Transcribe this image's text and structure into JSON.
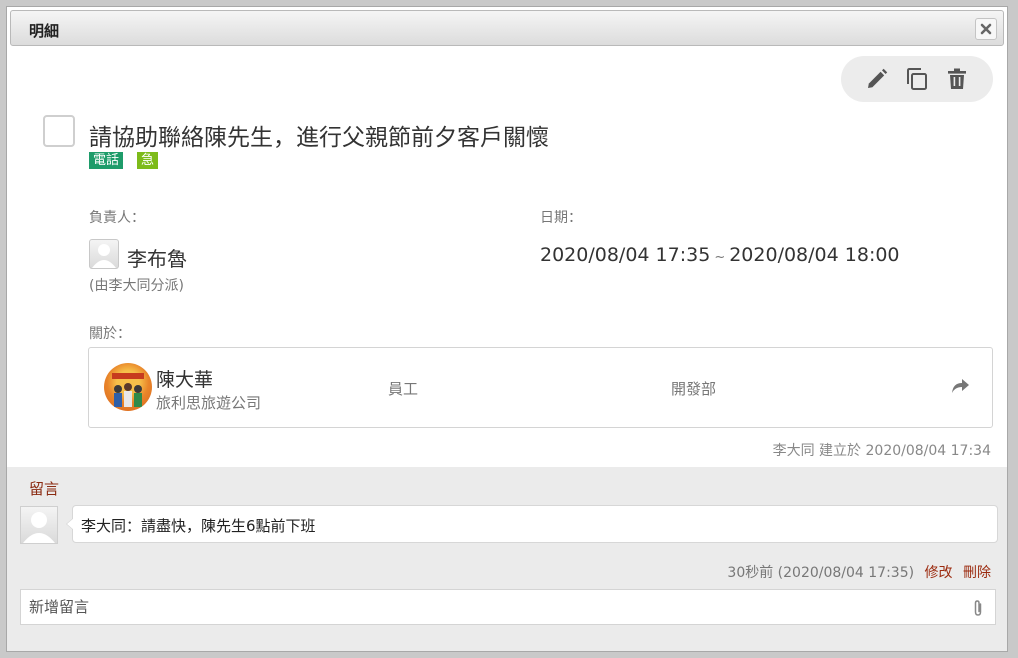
{
  "dialog": {
    "title": "明細",
    "close_icon": "close-icon"
  },
  "toolbar": {
    "icons": [
      "pencil-icon",
      "copy-icon",
      "trash-icon"
    ]
  },
  "task": {
    "title": "請協助聯絡陳先生，進行父親節前夕客戶關懷",
    "tags": [
      {
        "label": "電話",
        "color": "#1e9c6a"
      },
      {
        "label": "急",
        "color": "#7dbb1a"
      }
    ]
  },
  "owner": {
    "label": "負責人：",
    "name": "李布魯",
    "assigned_by": "(由李大同分派)"
  },
  "date": {
    "label": "日期：",
    "start": "2020/08/04 17:35",
    "separator": "~",
    "end": "2020/08/04 18:00"
  },
  "related": {
    "label": "關於：",
    "contact": {
      "name": "陳大華",
      "company": "旅利思旅遊公司",
      "role": "員工",
      "department": "開發部"
    }
  },
  "created_info": "李大同 建立於 2020/08/04 17:34",
  "comments": {
    "heading": "留言",
    "items": [
      {
        "text": "李大同：請盡快，陳先生6點前下班",
        "meta": "30秒前 (2020/08/04 17:35)",
        "edit_label": "修改",
        "delete_label": "刪除"
      }
    ],
    "new_placeholder": "新增留言"
  },
  "colors": {
    "accent_link": "#9b2a0e",
    "tag_phone": "#1e9c6a",
    "tag_urgent": "#7dbb1a"
  }
}
